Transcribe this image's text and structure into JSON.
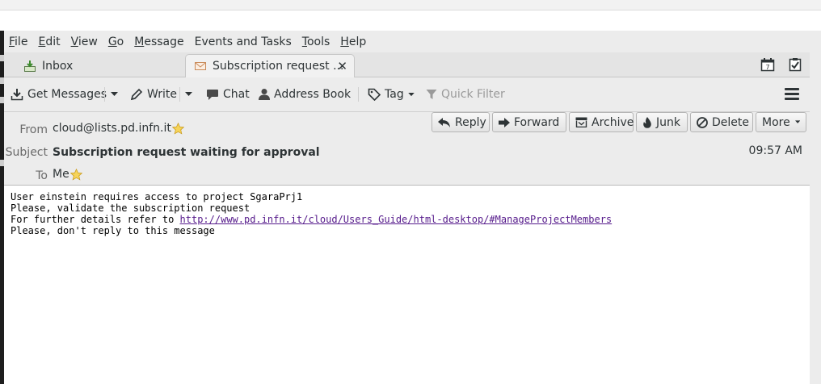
{
  "menubar": {
    "items": [
      {
        "label": "File",
        "key": "F",
        "rest": "ile"
      },
      {
        "label": "Edit",
        "key": "E",
        "rest": "dit"
      },
      {
        "label": "View",
        "key": "V",
        "rest": "iew"
      },
      {
        "label": "Go",
        "key": "G",
        "rest": "o"
      },
      {
        "label": "Message",
        "key": "M",
        "rest": "essage"
      },
      {
        "label": "Events and Tasks",
        "key": "",
        "rest": "Events and Tasks"
      },
      {
        "label": "Tools",
        "key": "T",
        "rest": "ools"
      },
      {
        "label": "Help",
        "key": "H",
        "rest": "elp"
      }
    ]
  },
  "tabs": {
    "inbox_label": "Inbox",
    "active_label": "Subscription request ...",
    "close_glyph": "✕",
    "inbox_icon": "inbox-tray-icon",
    "active_icon": "envelope-icon",
    "right_icons": [
      "calendar-icon",
      "tasks-icon"
    ]
  },
  "toolbar": {
    "get_messages": "Get Messages",
    "write": "Write",
    "chat": "Chat",
    "address_book": "Address Book",
    "tag": "Tag",
    "quick_filter": "Quick Filter"
  },
  "header": {
    "from_label": "From",
    "from_value": "cloud@lists.pd.infn.it",
    "subject_label": "Subject",
    "subject_value": "Subscription request waiting for approval",
    "to_label": "To",
    "to_value": "Me",
    "date": "09:57 AM",
    "buttons": {
      "reply": "Reply",
      "forward": "Forward",
      "archive": "Archive",
      "junk": "Junk",
      "delete": "Delete",
      "more": "More"
    }
  },
  "body": {
    "line1": "User einstein requires access to project SgaraPrj1",
    "line2": "Please, validate the subscription request",
    "line3_prefix": "For further details refer to ",
    "line3_link": "http://www.pd.infn.it/cloud/Users_Guide/html-desktop/#ManageProjectMembers",
    "line4": "Please, don't reply to this message"
  },
  "colors": {
    "chrome": "#ececec",
    "link": "#551a8b",
    "star": "#f2c230"
  }
}
